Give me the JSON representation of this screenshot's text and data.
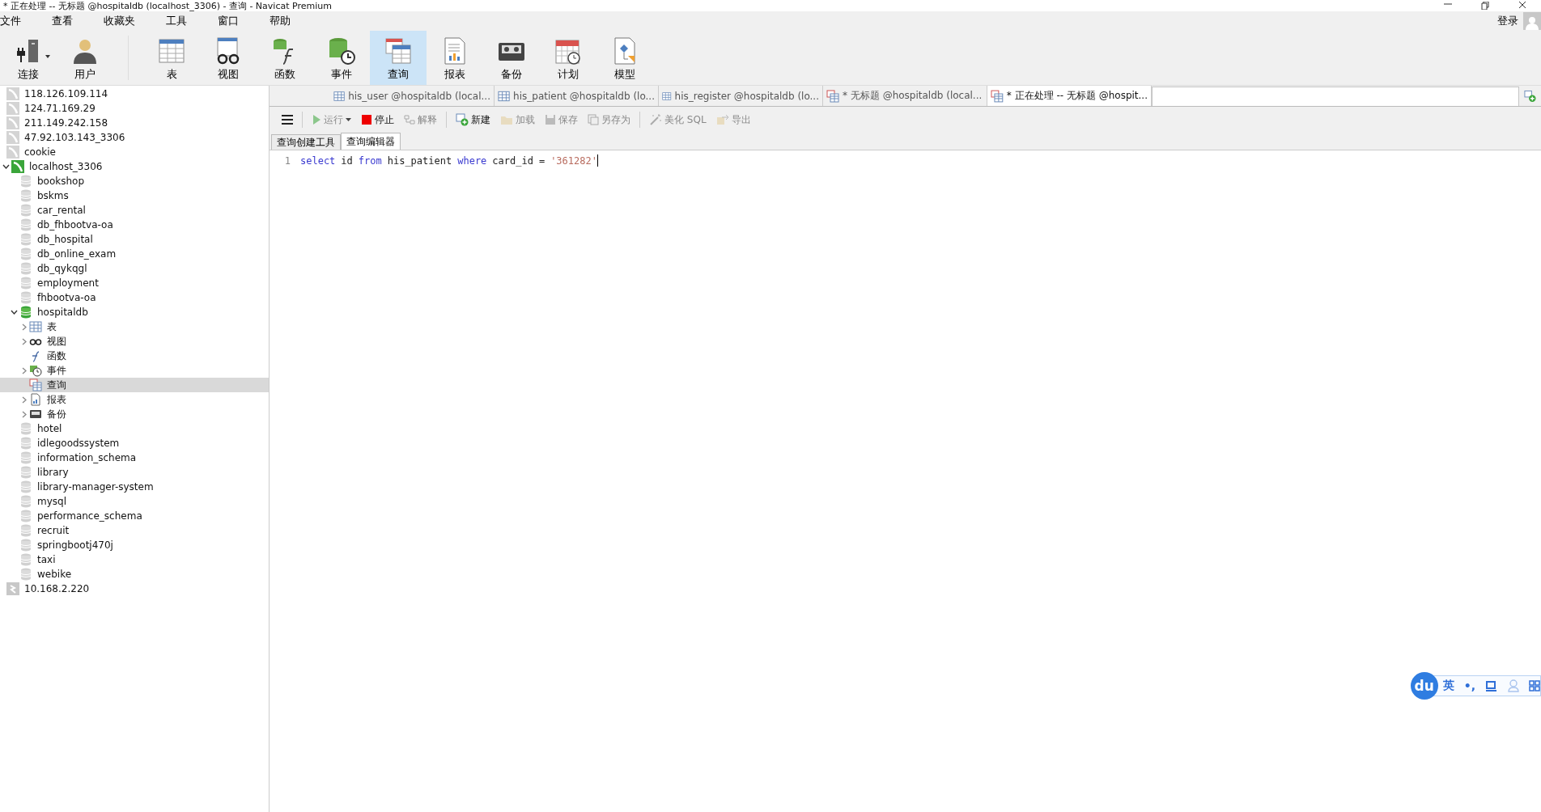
{
  "window": {
    "title": "* 正在处理 -- 无标题 @hospitaldb (localhost_3306) - 查询 - Navicat Premium"
  },
  "menu": [
    "文件",
    "查看",
    "收藏夹",
    "工具",
    "窗口",
    "帮助"
  ],
  "account": {
    "label": "登录"
  },
  "toolbar": [
    {
      "kind": "connect",
      "label": "连接",
      "selected": false,
      "dropdown": true
    },
    {
      "kind": "user",
      "label": "用户",
      "selected": false,
      "dropdown": false
    },
    {
      "kind": "table",
      "label": "表",
      "selected": false,
      "dropdown": false
    },
    {
      "kind": "view",
      "label": "视图",
      "selected": false,
      "dropdown": false
    },
    {
      "kind": "function",
      "label": "函数",
      "selected": false,
      "dropdown": false
    },
    {
      "kind": "event",
      "label": "事件",
      "selected": false,
      "dropdown": false
    },
    {
      "kind": "query",
      "label": "查询",
      "selected": true,
      "dropdown": false
    },
    {
      "kind": "report",
      "label": "报表",
      "selected": false,
      "dropdown": false
    },
    {
      "kind": "backup",
      "label": "备份",
      "selected": false,
      "dropdown": false
    },
    {
      "kind": "schedule",
      "label": "计划",
      "selected": false,
      "dropdown": false
    },
    {
      "kind": "model",
      "label": "模型",
      "selected": false,
      "dropdown": false
    }
  ],
  "tree": [
    {
      "kind": "server",
      "label": "118.126.109.114",
      "open": false,
      "selected": false
    },
    {
      "kind": "server",
      "label": "124.71.169.29",
      "open": false,
      "selected": false
    },
    {
      "kind": "server",
      "label": "211.149.242.158",
      "open": false,
      "selected": false
    },
    {
      "kind": "server",
      "label": "47.92.103.143_3306",
      "open": false,
      "selected": false
    },
    {
      "kind": "server",
      "label": "cookie",
      "open": false,
      "selected": false
    },
    {
      "kind": "server",
      "label": "localhost_3306",
      "open": true,
      "selected": false,
      "expanded": true,
      "children": [
        {
          "kind": "database",
          "label": "bookshop",
          "open": false,
          "selected": false
        },
        {
          "kind": "database",
          "label": "bskms",
          "open": false,
          "selected": false
        },
        {
          "kind": "database",
          "label": "car_rental",
          "open": false,
          "selected": false
        },
        {
          "kind": "database",
          "label": "db_fhbootva-oa",
          "open": false,
          "selected": false
        },
        {
          "kind": "database",
          "label": "db_hospital",
          "open": false,
          "selected": false
        },
        {
          "kind": "database",
          "label": "db_online_exam",
          "open": false,
          "selected": false
        },
        {
          "kind": "database",
          "label": "db_qykqgl",
          "open": false,
          "selected": false
        },
        {
          "kind": "database",
          "label": "employment",
          "open": false,
          "selected": false
        },
        {
          "kind": "database",
          "label": "fhbootva-oa",
          "open": false,
          "selected": false
        },
        {
          "kind": "database",
          "label": "hospitaldb",
          "open": true,
          "selected": false,
          "expanded": true,
          "children": [
            {
              "kind": "table",
              "label": "表",
              "selected": false,
              "expanded": false
            },
            {
              "kind": "view",
              "label": "视图",
              "selected": false,
              "expanded": false
            },
            {
              "kind": "function",
              "label": "函数",
              "selected": false
            },
            {
              "kind": "event",
              "label": "事件",
              "selected": false,
              "expanded": false
            },
            {
              "kind": "query",
              "label": "查询",
              "selected": true
            },
            {
              "kind": "report",
              "label": "报表",
              "selected": false,
              "expanded": false
            },
            {
              "kind": "backup",
              "label": "备份",
              "selected": false,
              "expanded": false
            }
          ]
        },
        {
          "kind": "database",
          "label": "hotel",
          "open": false,
          "selected": false
        },
        {
          "kind": "database",
          "label": "idlegoodssystem",
          "open": false,
          "selected": false
        },
        {
          "kind": "database",
          "label": "information_schema",
          "open": false,
          "selected": false
        },
        {
          "kind": "database",
          "label": "library",
          "open": false,
          "selected": false
        },
        {
          "kind": "database",
          "label": "library-manager-system",
          "open": false,
          "selected": false
        },
        {
          "kind": "database",
          "label": "mysql",
          "open": false,
          "selected": false
        },
        {
          "kind": "database",
          "label": "performance_schema",
          "open": false,
          "selected": false
        },
        {
          "kind": "database",
          "label": "recruit",
          "open": false,
          "selected": false
        },
        {
          "kind": "database",
          "label": "springbootj470j",
          "open": false,
          "selected": false
        },
        {
          "kind": "database",
          "label": "taxi",
          "open": false,
          "selected": false
        },
        {
          "kind": "database",
          "label": "webike",
          "open": false,
          "selected": false
        }
      ]
    },
    {
      "kind": "server-other",
      "label": "10.168.2.220",
      "selected": false
    }
  ],
  "tabs": [
    {
      "kind": "table",
      "label": "his_user @hospitaldb (local...",
      "selected": false
    },
    {
      "kind": "table",
      "label": "his_patient @hospitaldb (lo...",
      "selected": false
    },
    {
      "kind": "table",
      "label": "his_register @hospitaldb (lo...",
      "selected": false
    },
    {
      "kind": "query",
      "label": "* 无标题 @hospitaldb (local...",
      "selected": false
    },
    {
      "kind": "query",
      "label": "* 正在处理 -- 无标题 @hospit...",
      "selected": true
    }
  ],
  "query_toolbar": [
    {
      "kind": "run",
      "label": "运行",
      "disabled": true,
      "dropdown": true
    },
    {
      "kind": "stop",
      "label": "停止",
      "disabled": false
    },
    {
      "kind": "explain",
      "label": "解释",
      "disabled": true
    },
    {
      "kind": "new",
      "label": "新建",
      "disabled": false,
      "separator_before": true
    },
    {
      "kind": "load",
      "label": "加载",
      "disabled": true
    },
    {
      "kind": "save",
      "label": "保存",
      "disabled": true
    },
    {
      "kind": "saveas",
      "label": "另存为",
      "disabled": true
    },
    {
      "kind": "beautify",
      "label": "美化 SQL",
      "disabled": true,
      "separator_before": true
    },
    {
      "kind": "export",
      "label": "导出",
      "disabled": true
    }
  ],
  "subtabs": [
    {
      "label": "查询创建工具",
      "selected": false
    },
    {
      "label": "查询编辑器",
      "selected": true
    }
  ],
  "editor": {
    "lines": [
      {
        "number": "1",
        "tokens": [
          {
            "kind": "keyword",
            "text": "select"
          },
          {
            "kind": "plain",
            "text": "id"
          },
          {
            "kind": "keyword",
            "text": "from"
          },
          {
            "kind": "plain",
            "text": "his_patient"
          },
          {
            "kind": "keyword",
            "text": "where"
          },
          {
            "kind": "plain",
            "text": "card_id"
          },
          {
            "kind": "plain",
            "text": "="
          },
          {
            "kind": "string",
            "text": "'361282'"
          }
        ]
      }
    ]
  },
  "ime_bar": {
    "logo": "du",
    "mode": "英",
    "punctuation": "•,"
  }
}
